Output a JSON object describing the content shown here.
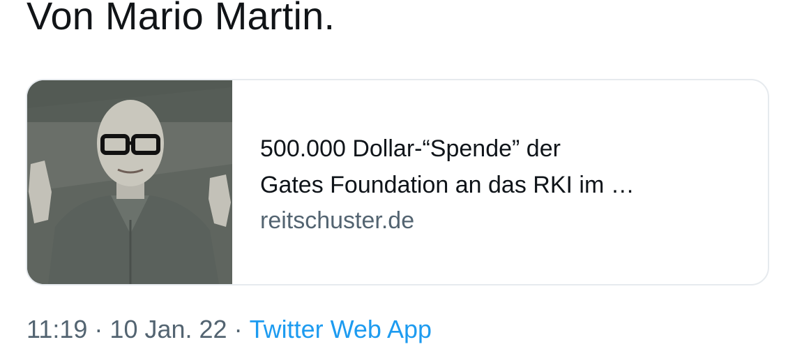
{
  "tweet": {
    "text": "Von Mario Martin."
  },
  "link_card": {
    "image": "man-in-grey-suit-thumbnail",
    "title_line1": "500.000 Dollar-“Spende” der",
    "title_line2": "Gates Foundation an das RKI im …",
    "domain": "reitschuster.de"
  },
  "meta": {
    "time": "11:19",
    "separator": "·",
    "date": "10 Jan. 22",
    "source": "Twitter Web App"
  },
  "colors": {
    "text": "#0f1419",
    "secondary": "#536471",
    "link": "#1d9bf0",
    "card_border": "#e6eaee"
  }
}
